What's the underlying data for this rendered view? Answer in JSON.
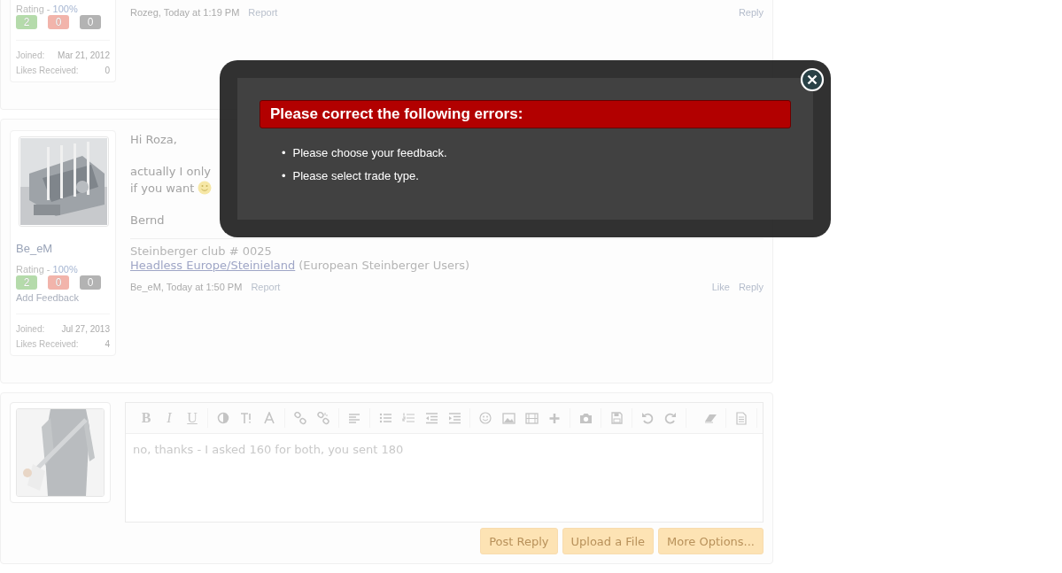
{
  "posts": [
    {
      "rating_label": "Rating -",
      "rating_value": "100%",
      "badges": [
        {
          "count": "2",
          "color": "#b5dbab"
        },
        {
          "count": "0",
          "color": "#f2b4ab"
        },
        {
          "count": "0",
          "color": "#b3b3b3"
        }
      ],
      "joined_label": "Joined:",
      "joined": "Mar 21, 2012",
      "likes_label": "Likes Received:",
      "likes": "0",
      "author_time": "Rozeg, Today at 1:19 PM",
      "report": "Report",
      "actions": [
        "Reply"
      ]
    },
    {
      "avatar": {
        "kind": "picture"
      },
      "username": "Be_eM",
      "rating_label": "Rating -",
      "rating_value": "100%",
      "badges": [
        {
          "count": "2",
          "color": "#b5dbab"
        },
        {
          "count": "0",
          "color": "#f2b4ab"
        },
        {
          "count": "0",
          "color": "#b3b3b3"
        }
      ],
      "add_feedback": "Add Feedback",
      "joined_label": "Joined:",
      "joined": "Jul 27, 2013",
      "likes_label": "Likes Received:",
      "likes": "4",
      "message": [
        [
          "Hi Roza,"
        ],
        [
          "actually I only",
          "if you want"
        ],
        [
          "Bernd"
        ]
      ],
      "signature": {
        "line": "Steinberger club # 0025",
        "link": "Headless Europe/Steinieland",
        "note": "(European Steinberger Users)"
      },
      "author_time": "Be_eM, Today at 1:50 PM",
      "report": "Report",
      "actions": [
        "Like",
        "Reply"
      ]
    }
  ],
  "reply_editor": {
    "avatar": {
      "kind": "picture"
    },
    "format_buttons": [
      "B",
      "I",
      "U"
    ],
    "text": "no, thanks - I asked 160 for both, you sent 180",
    "buttons": [
      "Post Reply",
      "Upload a File",
      "More Options..."
    ]
  },
  "error_dialog": {
    "title": "Please correct the following errors:",
    "errors": [
      {
        "bullet": "•",
        "text": "Please choose your feedback."
      },
      {
        "bullet": "•",
        "text": "Please select trade type."
      }
    ]
  }
}
